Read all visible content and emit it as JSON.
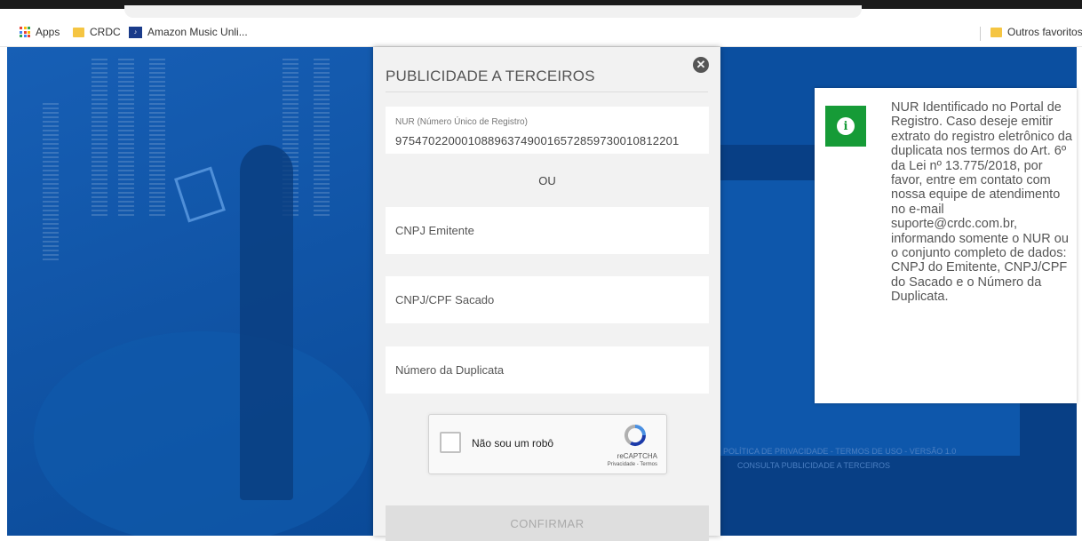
{
  "bookmarks": {
    "items": [
      {
        "label": "Apps",
        "icon": "apps-grid-icon"
      },
      {
        "label": "CRDC",
        "icon": "folder-icon"
      },
      {
        "label": "Amazon Music Unli...",
        "icon": "amazon-music-icon"
      }
    ],
    "other_favorites": "Outros favoritos"
  },
  "background": {
    "footer_links": "POLÍTICA DE PRIVACIDADE - TERMOS DE USO - VERSÃO 1.0",
    "footer_sub": "CONSULTA PUBLICIDADE A TERCEIROS"
  },
  "modal": {
    "title": "PUBLICIDADE A TERCEIROS",
    "nur_label": "NUR (Número Único de Registro)",
    "nur_value": "975470220001088963749001657285973001081220​1",
    "or_label": "OU",
    "cnpj_emitente_placeholder": "CNPJ Emitente",
    "cnpj_sacado_placeholder": "CNPJ/CPF Sacado",
    "numero_duplicata_placeholder": "Número da Duplicata",
    "recaptcha": {
      "label": "Não sou um robô",
      "brand": "reCAPTCHA",
      "links": "Privacidade - Termos"
    },
    "confirm_label": "CONFIRMAR"
  },
  "toast": {
    "message": "NUR Identificado no Portal de Registro. Caso deseje emitir extrato do registro eletrônico da duplicata nos termos do Art. 6º da Lei nº 13.775/2018, por favor, entre em contato com nossa equipe de atendimento no e-mail suporte@crdc.com.br, informando somente o NUR ou o conjunto completo de dados: CNPJ do Emitente, CNPJ/CPF do Sacado e o Número da Duplicata.",
    "icon": "info-icon",
    "color": "#169b37"
  }
}
